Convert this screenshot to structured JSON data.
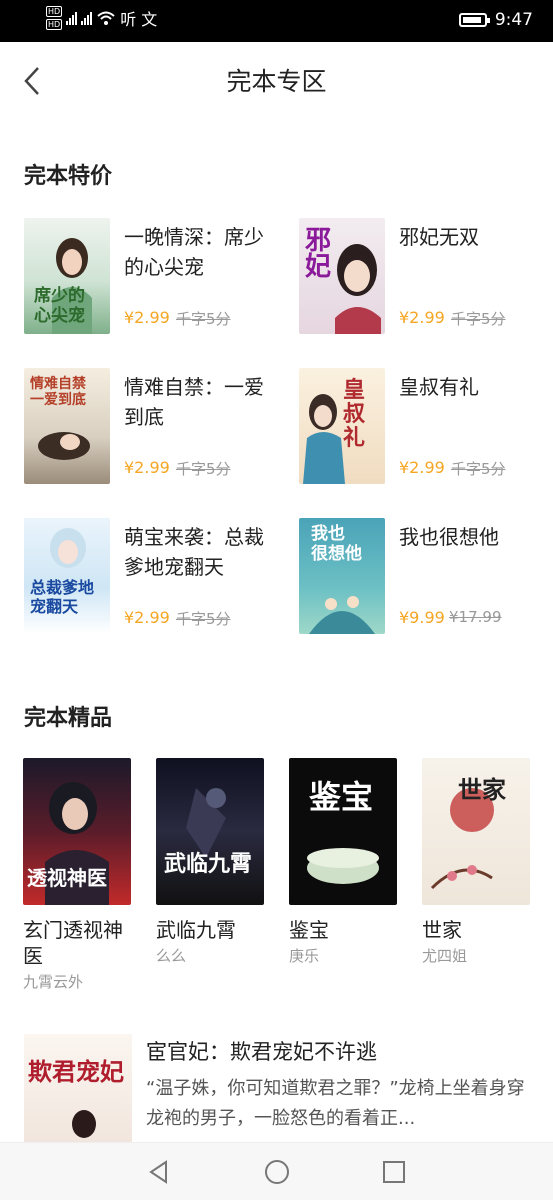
{
  "status": {
    "time": "9:47",
    "left_text": "听 文"
  },
  "header": {
    "title": "完本专区"
  },
  "deals": {
    "heading": "完本特价",
    "items": [
      {
        "title": "一晚情深：席少的心尖宠",
        "price": "¥2.99",
        "original": "千字5分"
      },
      {
        "title": "邪妃无双",
        "price": "¥2.99",
        "original": "千字5分"
      },
      {
        "title": "情难自禁：一爱到底",
        "price": "¥2.99",
        "original": "千字5分"
      },
      {
        "title": "皇叔有礼",
        "price": "¥2.99",
        "original": "千字5分"
      },
      {
        "title": "萌宝来袭：总裁爹地宠翻天",
        "price": "¥2.99",
        "original": "千字5分"
      },
      {
        "title": "我也很想他",
        "price": "¥9.99",
        "original": "¥17.99"
      }
    ]
  },
  "premium": {
    "heading": "完本精品",
    "items": [
      {
        "title": "玄门透视神医",
        "author": "九霄云外"
      },
      {
        "title": "武临九霄",
        "author": "么么"
      },
      {
        "title": "鉴宝",
        "author": "庚乐"
      },
      {
        "title": "世家",
        "author": "尤四姐"
      }
    ]
  },
  "featured": {
    "title": "宦官妃：欺君宠妃不许逃",
    "desc": "“温子姝，你可知道欺君之罪？”龙椅上坐着身穿龙袍的男子，一脸怒色的看着正..."
  },
  "icons": [
    "back-arrow-icon",
    "nav-back-icon",
    "nav-home-icon",
    "nav-recents-icon",
    "signal-icon",
    "wifi-icon",
    "battery-icon"
  ],
  "colors": {
    "price": "#f5a623",
    "strike": "#999999",
    "statusbar": "#000000"
  }
}
